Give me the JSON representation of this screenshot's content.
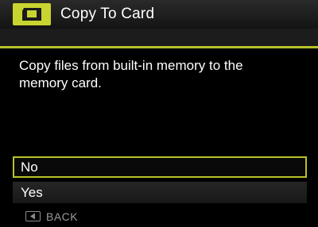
{
  "header": {
    "icon": "memory-card-icon",
    "title": "Copy To Card"
  },
  "dialog": {
    "message": "Copy files from built-in memory to the memory card."
  },
  "options": [
    {
      "label": "No",
      "selected": true
    },
    {
      "label": "Yes",
      "selected": false
    }
  ],
  "footer": {
    "back_icon": "back-arrow-icon",
    "back_label": "BACK"
  },
  "colors": {
    "accent": "#b7c22a",
    "icon_box": "#c8d430",
    "background": "#000000",
    "text": "#ffffff",
    "muted_text": "#9a9a9a"
  }
}
